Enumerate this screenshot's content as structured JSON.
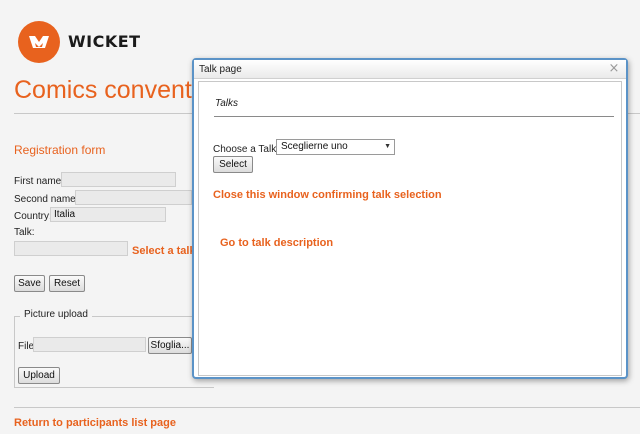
{
  "brand": {
    "name": "WICKET",
    "accent": "#e8621e"
  },
  "page": {
    "title": "Comics convention",
    "form_title": "Registration form",
    "fields": {
      "first_name_label": "First name:",
      "second_name_label": "Second name:",
      "country_label": "Country:",
      "country_value": "Italia",
      "talk_label": "Talk:",
      "select_talk_link": "Select a talk"
    },
    "buttons": {
      "save": "Save",
      "reset": "Reset"
    },
    "upload": {
      "legend": "Picture upload",
      "file_label": "File",
      "browse": "Sfoglia...",
      "upload": "Upload"
    },
    "return_link": "Return to participants list page"
  },
  "modal": {
    "title": "Talk page",
    "heading": "Talks",
    "choose_label": "Choose a Talk:",
    "select_value": "Sceglierne uno",
    "select_button": "Select",
    "close_link": "Close this window confirming talk selection",
    "description_link": "Go to talk description",
    "close_icon": "×"
  }
}
